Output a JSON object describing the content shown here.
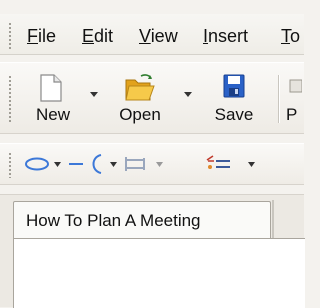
{
  "menu": {
    "items": [
      {
        "label": "File"
      },
      {
        "label": "Edit"
      },
      {
        "label": "View"
      },
      {
        "label": "Insert"
      },
      {
        "label": "To"
      }
    ]
  },
  "toolbar": {
    "new_label": "New",
    "open_label": "Open",
    "save_label": "Save",
    "next_label": "P"
  },
  "document_tab": {
    "title": "How To Plan  A Meeting"
  },
  "colors": {
    "save_icon": "#2a61c7",
    "folder_icon": "#f2b424",
    "draw_tool": "#3c78d8"
  }
}
